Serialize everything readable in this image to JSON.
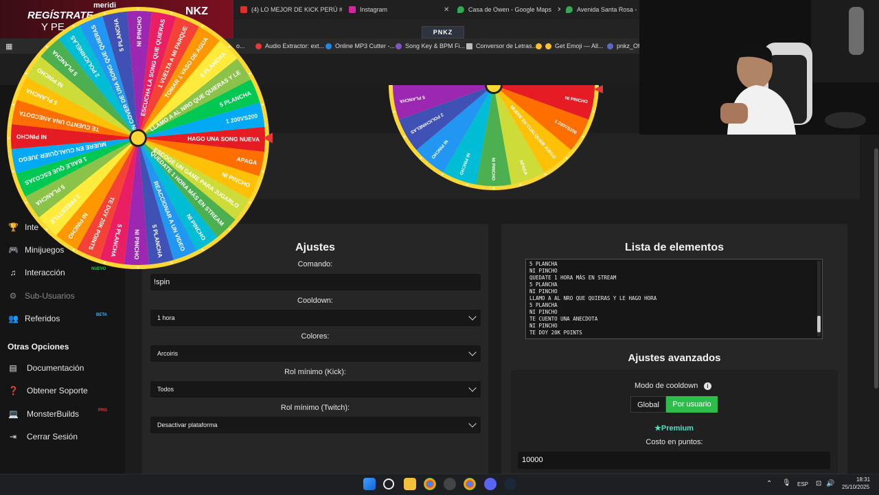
{
  "browser": {
    "tabs": [
      {
        "label": "(4) LO MEJOR DE KICK PERÚ #"
      },
      {
        "label": "Instagram"
      },
      {
        "label": "Casa de Owen - Google Maps"
      },
      {
        "label": "Avenida Santa Rosa - Goo"
      }
    ],
    "bookmarks": [
      {
        "label": "o..."
      },
      {
        "label": "Audio Extractor: ext..."
      },
      {
        "label": "Online MP3 Cutter -..."
      },
      {
        "label": "Song Key & BPM Fi..."
      },
      {
        "label": "Conversor de Letras..."
      },
      {
        "label": "Get Emoji — All..."
      },
      {
        "label": "pnkz_Ofic"
      }
    ],
    "site_logo": "PNKZ"
  },
  "promo": {
    "line1": "REGÍSTRATE",
    "line2": "Y PE",
    "overlay": "meridi",
    "overlay2": "NKZ"
  },
  "sidebar": {
    "items": [
      {
        "label": "Inte"
      },
      {
        "label": "Minijuegos"
      },
      {
        "label": "Interacción",
        "tag": "NUEVO"
      },
      {
        "label": "Sub-Usuarios"
      },
      {
        "label": "Referidos",
        "tag": "BETA"
      }
    ],
    "section_title": "Otras Opciones",
    "other": [
      {
        "label": "Documentación"
      },
      {
        "label": "Obtener Soporte"
      },
      {
        "label": "MonsterBuilds",
        "tag": "PRO"
      },
      {
        "label": "Cerrar Sesión"
      }
    ]
  },
  "settings": {
    "title": "Ajustes",
    "command_label": "Comando:",
    "command_value": "!spin",
    "cooldown_label": "Cooldown:",
    "cooldown_value": "1 hora",
    "colors_label": "Colores:",
    "colors_value": "Arcoiris",
    "kick_role_label": "Rol mínimo (Kick):",
    "kick_role_value": "Todos",
    "twitch_role_label": "Rol mínimo (Twitch):",
    "twitch_role_value": "Desactivar plataforma"
  },
  "list": {
    "title": "Lista de elementos",
    "items": [
      "5 PLANCHA",
      "NI PINCHO",
      "QUEDATE 1 HORA MÁS EN STREAM",
      "5 PLANCHA",
      "NI PINCHO",
      "LLAMO A AL NRO QUE QUIERAS Y LE HAGO HORA",
      "5 PLANCHA",
      "NI PINCHO",
      "TE CUENTO UNA ANECDOTA",
      "NI PINCHO",
      "TE DOY 20K POINTS"
    ]
  },
  "advanced": {
    "title": "Ajustes avanzados",
    "cooldown_mode_label": "Modo de cooldown",
    "mode_global": "Global",
    "mode_user": "Por usuario",
    "mode_selected": "Por usuario",
    "premium_label": "Premium",
    "cost_label": "Costo en puntos:",
    "cost_value": "10000"
  },
  "wheel": {
    "big_labels": [
      "HAGO UNA SONG NUEVA",
      "APAGA",
      "NI PINCHO",
      "ESCOGE UN GAME PARA JUGARLO",
      "QUEDATE 1 HORA MÁS EN STREAM",
      "NI PINCHO",
      "REACCIONAR A UN VIDEO",
      "5 PLANCHA",
      "NI PINCHO",
      "5 PLANCHA",
      "TE DOY 20K POINTS",
      "NI PINCHO",
      "1 FREESTYLE",
      "5 PLANCHA",
      "1 BAILE QUE ESCOJAS",
      "MUERE EN CUALQUIER JUEGO",
      "NI PINCHO",
      "TE CUENTO UNA ANECDOTA",
      "5 PLANCHA",
      "NI PINCHO",
      "5 PLANCHA",
      "2 POLICHINELAS",
      "UN COVER DE UNA SONG QUE QUIERAS",
      "5 PLANCHA",
      "NI PINCHO",
      "ESCUCHA LA SONG QUE QUIERAS",
      "1 VUELTA A MI PARQUE",
      "TOMAR 1 VASO DE AGUA",
      "5 PLANCHA",
      "LLAMO A AL NRO QUE QUIERAS Y LE",
      "5 PLANCHA",
      "1 200VS200"
    ],
    "small_labels": [
      "NI PINCHO",
      "1 200VS200",
      "MUERE EN CUALQUIER JUEGO",
      "APAGA",
      "NI PINCHO",
      "NI PINCHO",
      "NI PINCHO",
      "2 POLICHINELAS",
      "5 PLANCHA",
      "TE DOY 20K POINTS",
      "5 PLANCHA",
      "QUEDATE 1 HORA MÁS EN STREAM",
      "TOMAR 1 VASO DE AGUA",
      "1 FREESTYLE",
      "5 PLANCHA",
      "1 VUELTA A MI PARQUE",
      "UN COVER DE UNA SONG",
      "5 PLANCHA"
    ]
  },
  "taskbar": {
    "lang": "ESP",
    "time": "18:31",
    "date": "25/10/2025"
  }
}
